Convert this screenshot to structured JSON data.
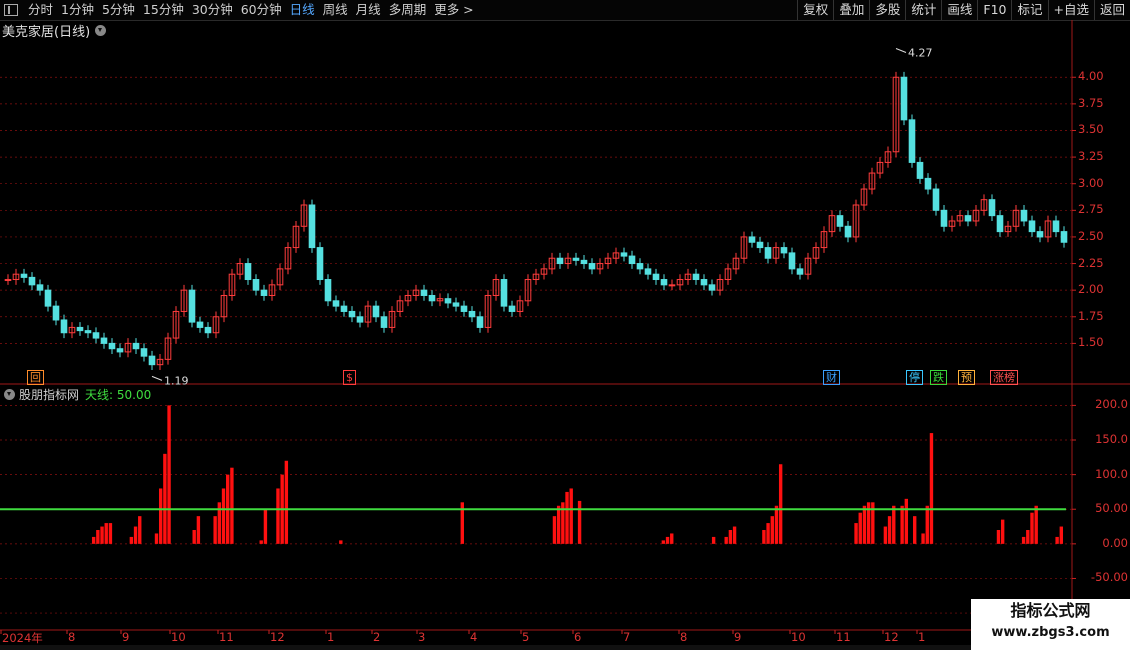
{
  "toolbar": {
    "periods": [
      "分时",
      "1分钟",
      "5分钟",
      "15分钟",
      "30分钟",
      "60分钟",
      "日线",
      "周线",
      "月线",
      "多周期",
      "更多 >"
    ],
    "active_period": "日线",
    "right_buttons": [
      "复权",
      "叠加",
      "多股",
      "统计",
      "画线",
      "F10",
      "标记",
      "+自选",
      "返回"
    ]
  },
  "main_pane": {
    "stock_title": "美克家居(日线)",
    "high_marker": "4.27",
    "low_marker": "1.19",
    "price_axis": [
      "4.00",
      "3.75",
      "3.50",
      "3.25",
      "3.00",
      "2.75",
      "2.50",
      "2.25",
      "2.00",
      "1.75",
      "1.50"
    ],
    "event_tags": [
      {
        "text": "回",
        "color": "#ff8c2a"
      },
      {
        "text": "$",
        "color": "#ff3c3c"
      },
      {
        "text": "财",
        "color": "#3aa0ff"
      },
      {
        "text": "停",
        "color": "#3ac8ff"
      },
      {
        "text": "跌",
        "color": "#3ad83a"
      },
      {
        "text": "预",
        "color": "#ffb23a"
      },
      {
        "text": "涨榜",
        "color": "#ff5050"
      }
    ]
  },
  "indicator_pane": {
    "name": "股朋指标网",
    "line_label": "天线: 50.00",
    "line_value": 50,
    "axis": [
      "200.0",
      "150.0",
      "100.0",
      "50.00",
      "0.00",
      "-50.00",
      "-100.0"
    ]
  },
  "date_axis": [
    "2024年",
    "8",
    "9",
    "10",
    "11",
    "12",
    "1",
    "2",
    "3",
    "4",
    "5",
    "6",
    "7",
    "8",
    "9",
    "10",
    "11",
    "12",
    "1"
  ],
  "watermark": {
    "title": "指标公式网",
    "url": "www.zbgs3.com"
  },
  "colors": {
    "up": "#ff3c3c",
    "down": "#55e0e0",
    "grid": "#8a1010",
    "tianxian": "#3fdc3f",
    "bar": "#ff1010"
  },
  "chart_data": {
    "type": "candlestick+bar",
    "price_range": [
      1.19,
      4.27
    ],
    "indicator_range": [
      -100,
      200
    ],
    "price_closes": [
      2.1,
      2.15,
      2.12,
      2.05,
      2.0,
      1.85,
      1.72,
      1.6,
      1.65,
      1.62,
      1.6,
      1.55,
      1.5,
      1.45,
      1.42,
      1.5,
      1.45,
      1.38,
      1.3,
      1.35,
      1.55,
      1.8,
      2.0,
      1.7,
      1.65,
      1.6,
      1.75,
      1.95,
      2.15,
      2.25,
      2.1,
      2.0,
      1.95,
      2.05,
      2.2,
      2.4,
      2.6,
      2.8,
      2.4,
      2.1,
      1.9,
      1.85,
      1.8,
      1.75,
      1.7,
      1.85,
      1.75,
      1.65,
      1.8,
      1.9,
      1.95,
      2.0,
      1.95,
      1.9,
      1.92,
      1.88,
      1.85,
      1.8,
      1.75,
      1.65,
      1.95,
      2.1,
      1.85,
      1.8,
      1.9,
      2.1,
      2.15,
      2.2,
      2.3,
      2.25,
      2.3,
      2.28,
      2.25,
      2.2,
      2.25,
      2.3,
      2.35,
      2.32,
      2.25,
      2.2,
      2.15,
      2.1,
      2.05,
      2.05,
      2.1,
      2.15,
      2.1,
      2.05,
      2.0,
      2.1,
      2.2,
      2.3,
      2.5,
      2.45,
      2.4,
      2.3,
      2.4,
      2.35,
      2.2,
      2.15,
      2.3,
      2.4,
      2.55,
      2.7,
      2.6,
      2.5,
      2.8,
      2.95,
      3.1,
      3.2,
      3.3,
      4.0,
      3.6,
      3.2,
      3.05,
      2.95,
      2.75,
      2.6,
      2.65,
      2.7,
      2.65,
      2.75,
      2.85,
      2.7,
      2.55,
      2.6,
      2.75,
      2.65,
      2.55,
      2.5,
      2.65,
      2.55,
      2.45
    ],
    "indicator_values": [
      0,
      0,
      0,
      0,
      0,
      0,
      0,
      0,
      0,
      0,
      0,
      0,
      0,
      0,
      0,
      0,
      0,
      0,
      0,
      0,
      0,
      10,
      20,
      25,
      30,
      30,
      0,
      0,
      0,
      0,
      10,
      25,
      40,
      0,
      0,
      0,
      15,
      80,
      130,
      200,
      0,
      0,
      0,
      0,
      0,
      20,
      40,
      0,
      0,
      0,
      40,
      60,
      80,
      100,
      110,
      0,
      0,
      0,
      0,
      0,
      0,
      5,
      50,
      0,
      0,
      80,
      100,
      120,
      0,
      0,
      0,
      0,
      0,
      0,
      0,
      0,
      0,
      0,
      0,
      0,
      5,
      0,
      0,
      0,
      0,
      0,
      0,
      0,
      0,
      0,
      0,
      0,
      0,
      0,
      0,
      0,
      0,
      0,
      0,
      0,
      0,
      0,
      0,
      0,
      0,
      0,
      0,
      0,
      0,
      60,
      0,
      0,
      0,
      0,
      0,
      0,
      0,
      0,
      0,
      0,
      0,
      0,
      0,
      0,
      0,
      0,
      0,
      0,
      0,
      0,
      0,
      40,
      55,
      60,
      75,
      80,
      0,
      62,
      0,
      0,
      0,
      0,
      0,
      0,
      0,
      0,
      0,
      0,
      0,
      0,
      0,
      0,
      0,
      0,
      0,
      0,
      0,
      5,
      10,
      15,
      0,
      0,
      0,
      0,
      0,
      0,
      0,
      0,
      0,
      10,
      0,
      0,
      10,
      20,
      25,
      0,
      0,
      0,
      0,
      0,
      0,
      20,
      30,
      40,
      55,
      115,
      0,
      0,
      0,
      0,
      0,
      0,
      0,
      0,
      0,
      0,
      0,
      0,
      0,
      0,
      0,
      0,
      0,
      30,
      45,
      55,
      60,
      60,
      0,
      0,
      25,
      40,
      55,
      0,
      55,
      65,
      0,
      40,
      0,
      15,
      55,
      160,
      0,
      0,
      0,
      0,
      0,
      0,
      0,
      0,
      0,
      0,
      0,
      0,
      0,
      0,
      0,
      20,
      35,
      0,
      0,
      0,
      0,
      10,
      20,
      45,
      55,
      0,
      0,
      0,
      0,
      10,
      25,
      0
    ]
  }
}
